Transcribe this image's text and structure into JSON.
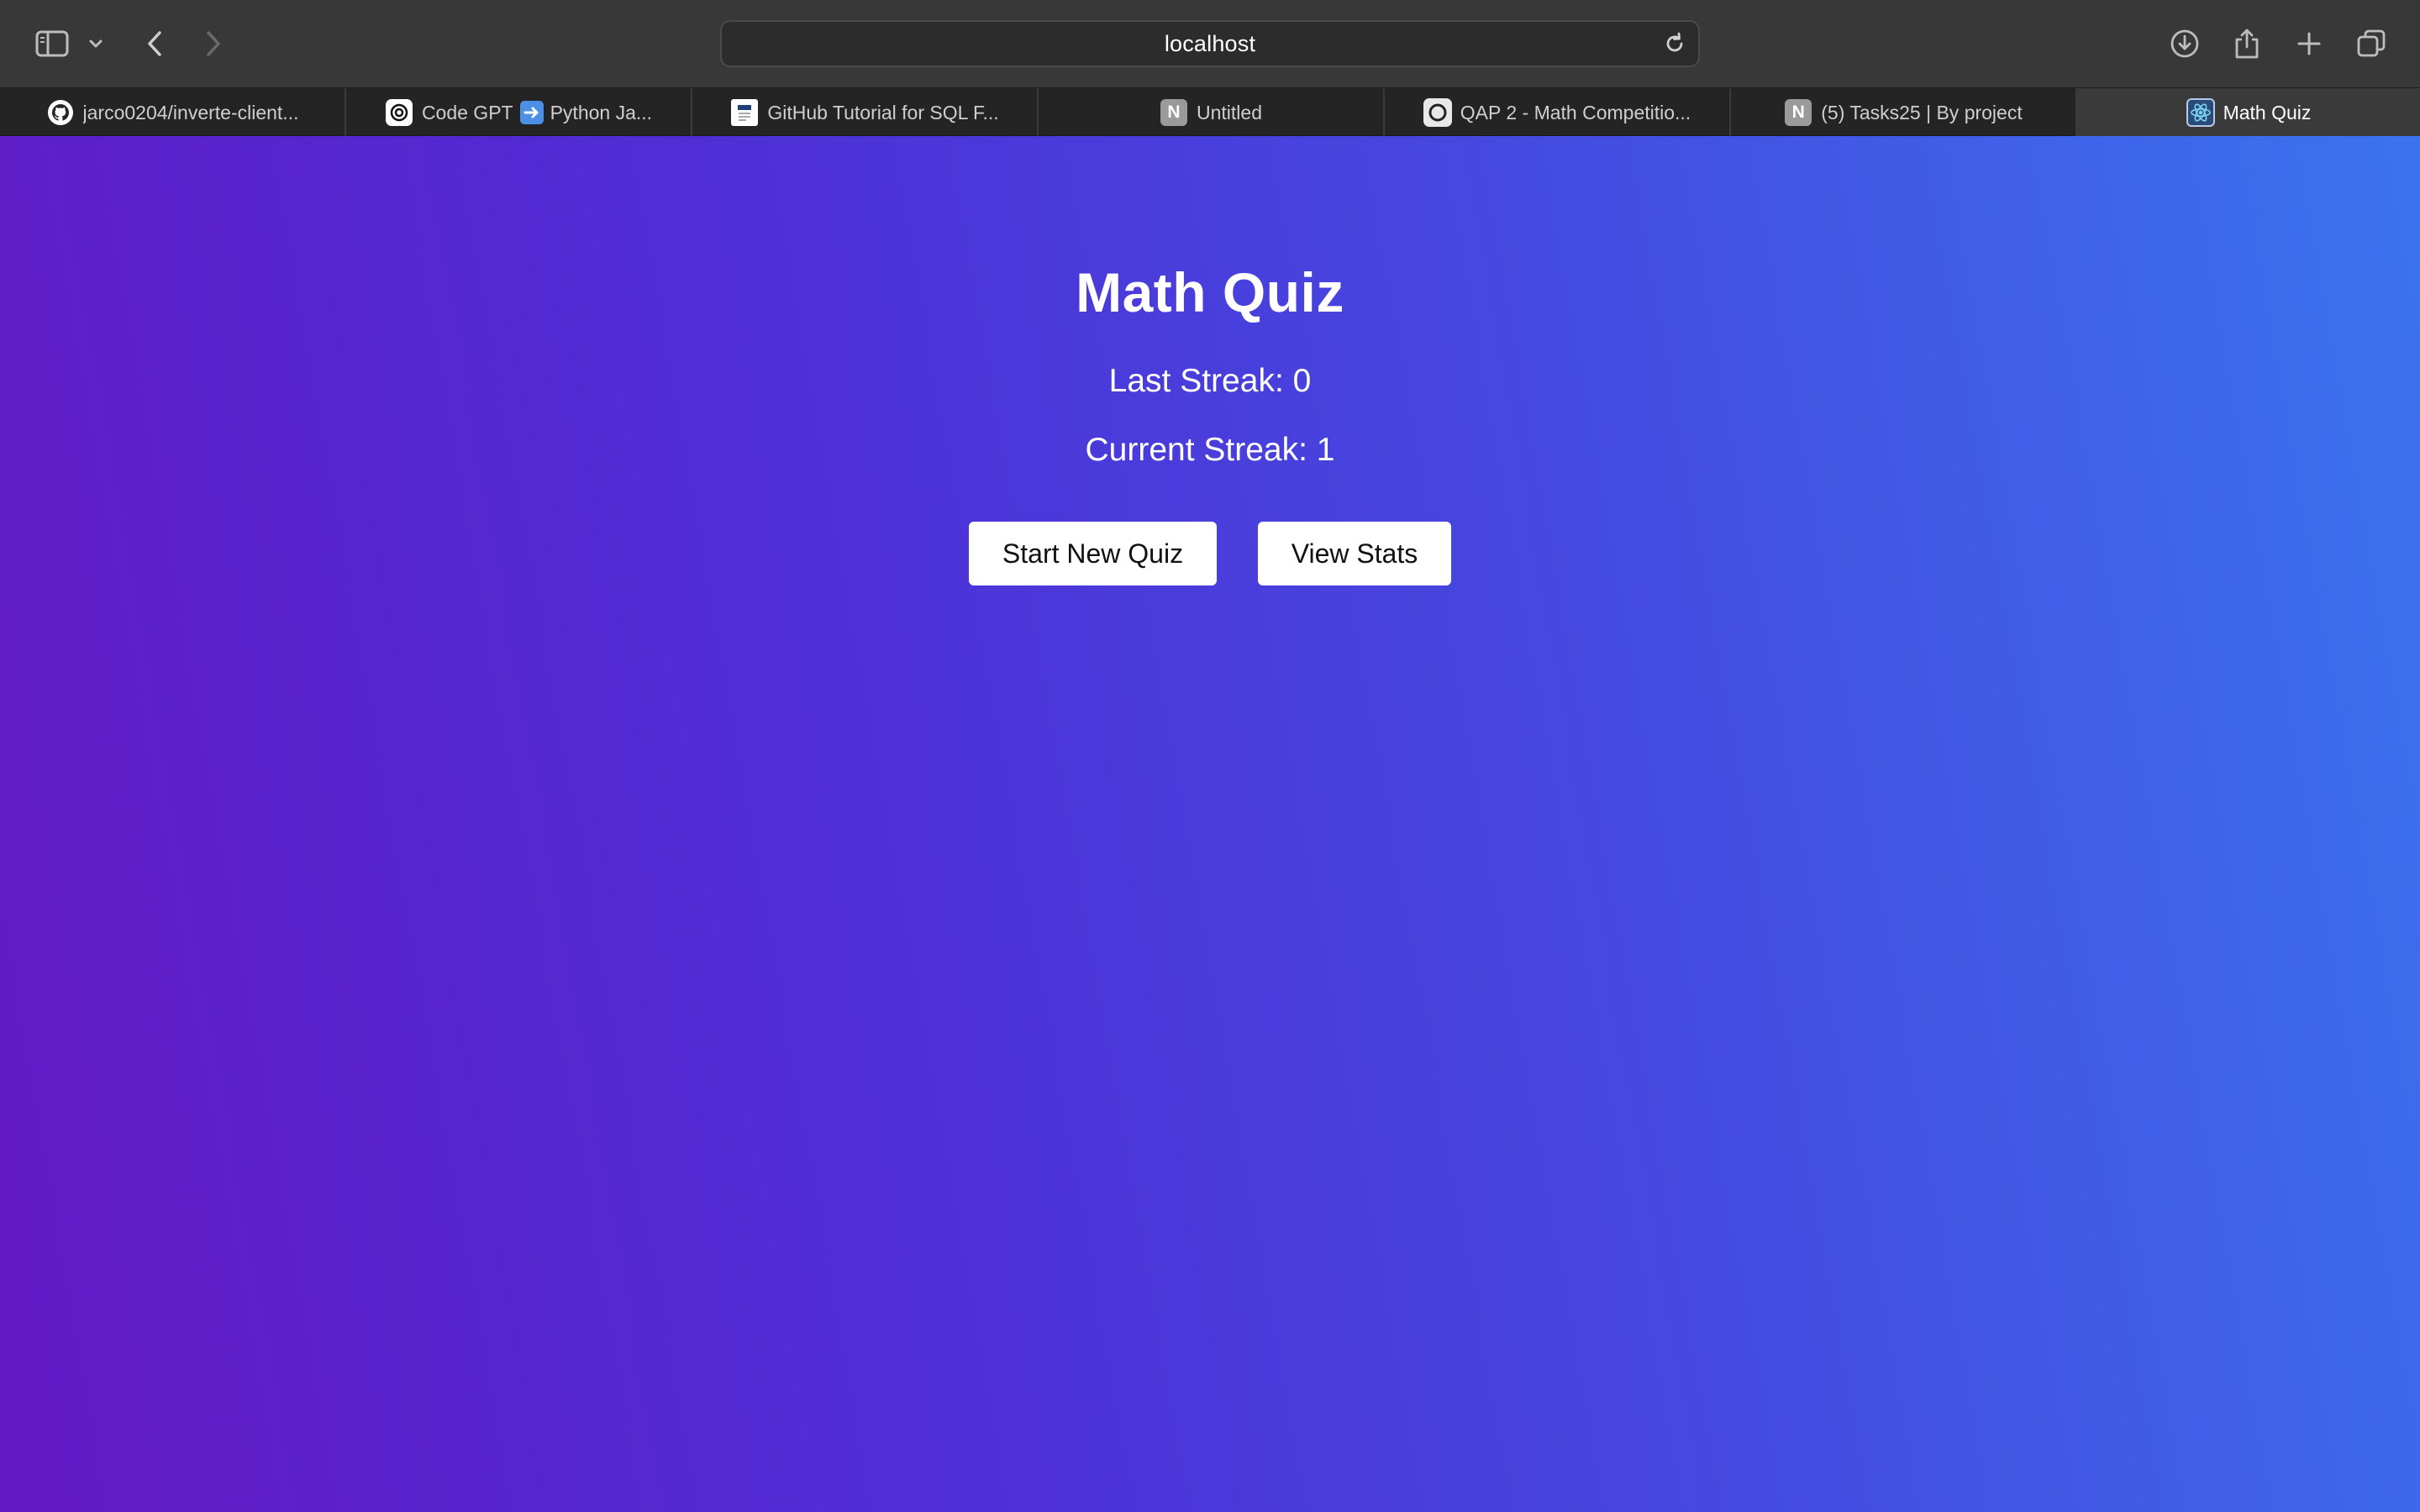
{
  "browser": {
    "address": "localhost",
    "toolbar_icons": {
      "sidebar": "sidebar-icon",
      "sidebar_menu": "chevron-down-icon",
      "back": "chevron-left-icon",
      "forward": "chevron-right-icon",
      "reload": "reload-icon",
      "downloads": "download-icon",
      "share": "share-icon",
      "new_tab": "plus-icon",
      "tab_overview": "tab-overview-icon"
    },
    "tabs": [
      {
        "label": "jarco0204/inverte-client...",
        "icon": "github-icon",
        "active": false
      },
      {
        "label_pre": "Code GPT",
        "label_post": "Python Ja...",
        "icon": "openai-icon",
        "active": false
      },
      {
        "label": "GitHub Tutorial for SQL F...",
        "icon": "document-icon",
        "active": false
      },
      {
        "label": "Untitled",
        "icon": "notion-icon",
        "active": false
      },
      {
        "label": "QAP 2 - Math Competitio...",
        "icon": "circle-app-icon",
        "active": false
      },
      {
        "label": "(5) Tasks25 | By project",
        "icon": "notion-icon",
        "active": false
      },
      {
        "label": "Math Quiz",
        "icon": "react-icon",
        "active": true
      }
    ]
  },
  "page": {
    "title": "Math Quiz",
    "last_streak": "Last Streak: 0",
    "current_streak": "Current Streak: 1",
    "start_button": "Start New Quiz",
    "stats_button": "View Stats"
  },
  "colors": {
    "gradient_start": "#6319c4",
    "gradient_end": "#3b73ef",
    "toolbar": "#383838",
    "tabbar": "#242424",
    "active_tab": "#3a3a3a"
  }
}
